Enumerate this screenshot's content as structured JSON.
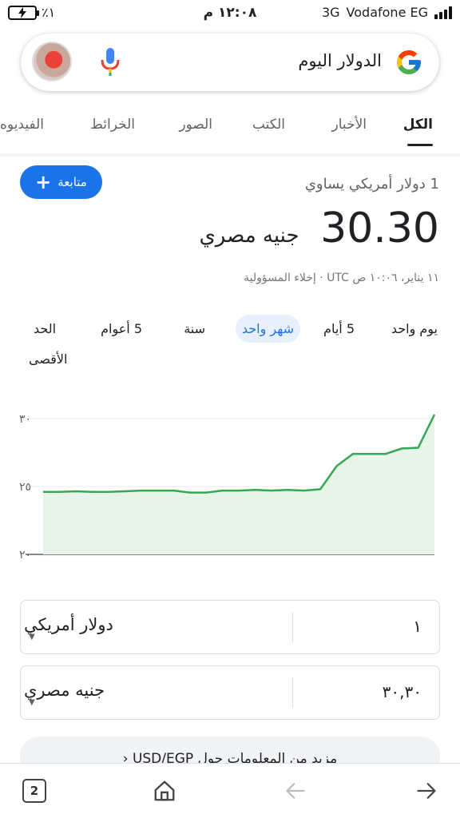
{
  "status_bar": {
    "battery_percent": "٪١",
    "time": "١٢:٠٨ م",
    "network": "3G",
    "carrier": "Vodafone EG"
  },
  "search": {
    "query": "الدولار اليوم"
  },
  "tabs": [
    {
      "label": "الكل",
      "active": true
    },
    {
      "label": "الأخبار",
      "active": false
    },
    {
      "label": "الكتب",
      "active": false
    },
    {
      "label": "الصور",
      "active": false
    },
    {
      "label": "الخرائط",
      "active": false
    },
    {
      "label": "الفيديوه",
      "active": false
    }
  ],
  "result": {
    "follow_label": "متابعة",
    "equal_text": "1 دولار أمريكي يساوي",
    "rate": "30.30",
    "rate_unit": "جنيه مصري",
    "timestamp": "١١ يناير، ١٠:٠٦ ص UTC · إخلاء المسؤولية"
  },
  "ranges": [
    {
      "label": "يوم واحد",
      "active": false
    },
    {
      "label": "5 أيام",
      "active": false
    },
    {
      "label": "شهر واحد",
      "active": true
    },
    {
      "label": "سنة",
      "active": false
    },
    {
      "label": "5 أعوام",
      "active": false
    },
    {
      "label": "الحد",
      "active": false
    },
    {
      "label": "الأقصى",
      "active": false
    }
  ],
  "chart_data": {
    "type": "area",
    "y_tick_labels": [
      "٣٠",
      "٢٥",
      "٢٠"
    ],
    "y_ticks": [
      30,
      25,
      20
    ],
    "ylim": [
      20,
      30
    ],
    "grid": true,
    "line_color": "#34a853",
    "fill_color": "#e6f4ea",
    "values": [
      24.6,
      24.6,
      24.65,
      24.6,
      24.6,
      24.65,
      24.7,
      24.7,
      24.7,
      24.55,
      24.55,
      24.7,
      24.7,
      24.75,
      24.7,
      24.75,
      24.7,
      24.8,
      26.5,
      27.4,
      27.4,
      27.4,
      27.8,
      27.85,
      30.3
    ]
  },
  "converter": {
    "from_amount": "١",
    "from_currency": "دولار أمريكي",
    "to_amount": "٣٠,٣٠",
    "to_currency": "جنيه مصري"
  },
  "more_info": {
    "text": "مزيد من المعلومات حول USD/EGP"
  },
  "bottom_nav": {
    "tab_count": "2"
  },
  "colors": {
    "accent": "#1a73e8",
    "chart_line": "#34a853"
  }
}
